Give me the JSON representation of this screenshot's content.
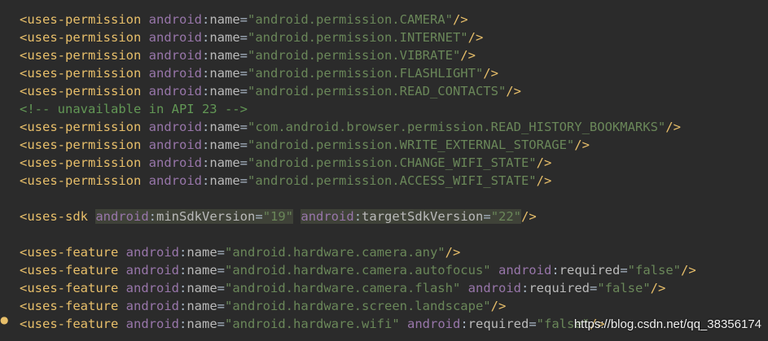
{
  "lines": [
    {
      "kind": "element",
      "tag": "<uses-permission",
      "attrs": [
        {
          "ns": "android",
          "name": "name",
          "value": "\"android.permission.CAMERA\""
        }
      ],
      "end": "/>"
    },
    {
      "kind": "element",
      "tag": "<uses-permission",
      "attrs": [
        {
          "ns": "android",
          "name": "name",
          "value": "\"android.permission.INTERNET\""
        }
      ],
      "end": "/>"
    },
    {
      "kind": "element",
      "tag": "<uses-permission",
      "attrs": [
        {
          "ns": "android",
          "name": "name",
          "value": "\"android.permission.VIBRATE\""
        }
      ],
      "end": "/>"
    },
    {
      "kind": "element",
      "tag": "<uses-permission",
      "attrs": [
        {
          "ns": "android",
          "name": "name",
          "value": "\"android.permission.FLASHLIGHT\""
        }
      ],
      "end": "/>"
    },
    {
      "kind": "element",
      "tag": "<uses-permission",
      "attrs": [
        {
          "ns": "android",
          "name": "name",
          "value": "\"android.permission.READ_CONTACTS\""
        }
      ],
      "end": "/>"
    },
    {
      "kind": "comment",
      "text": "<!-- unavailable in API 23 -->"
    },
    {
      "kind": "element",
      "tag": "<uses-permission",
      "attrs": [
        {
          "ns": "android",
          "name": "name",
          "value": "\"com.android.browser.permission.READ_HISTORY_BOOKMARKS\""
        }
      ],
      "end": "/>"
    },
    {
      "kind": "element",
      "tag": "<uses-permission",
      "attrs": [
        {
          "ns": "android",
          "name": "name",
          "value": "\"android.permission.WRITE_EXTERNAL_STORAGE\""
        }
      ],
      "end": "/>"
    },
    {
      "kind": "element",
      "tag": "<uses-permission",
      "attrs": [
        {
          "ns": "android",
          "name": "name",
          "value": "\"android.permission.CHANGE_WIFI_STATE\""
        }
      ],
      "end": "/>"
    },
    {
      "kind": "element",
      "tag": "<uses-permission",
      "attrs": [
        {
          "ns": "android",
          "name": "name",
          "value": "\"android.permission.ACCESS_WIFI_STATE\""
        }
      ],
      "end": "/>"
    },
    {
      "kind": "blank"
    },
    {
      "kind": "element",
      "tag": "<uses-sdk",
      "attrs": [
        {
          "ns": "android",
          "name": "minSdkVersion",
          "value": "\"19\"",
          "highlight": true
        },
        {
          "ns": "android",
          "name": "targetSdkVersion",
          "value": "\"22\"",
          "highlight": true
        }
      ],
      "end": "/>"
    },
    {
      "kind": "blank"
    },
    {
      "kind": "element",
      "tag": "<uses-feature",
      "attrs": [
        {
          "ns": "android",
          "name": "name",
          "value": "\"android.hardware.camera.any\""
        }
      ],
      "end": "/>"
    },
    {
      "kind": "element",
      "tag": "<uses-feature",
      "attrs": [
        {
          "ns": "android",
          "name": "name",
          "value": "\"android.hardware.camera.autofocus\""
        },
        {
          "ns": "android",
          "name": "required",
          "value": "\"false\""
        }
      ],
      "end": "/>"
    },
    {
      "kind": "element",
      "tag": "<uses-feature",
      "attrs": [
        {
          "ns": "android",
          "name": "name",
          "value": "\"android.hardware.camera.flash\""
        },
        {
          "ns": "android",
          "name": "required",
          "value": "\"false\""
        }
      ],
      "end": "/>"
    },
    {
      "kind": "element",
      "tag": "<uses-feature",
      "attrs": [
        {
          "ns": "android",
          "name": "name",
          "value": "\"android.hardware.screen.landscape\""
        }
      ],
      "end": "/>"
    },
    {
      "kind": "element",
      "tag": "<uses-feature",
      "attrs": [
        {
          "ns": "android",
          "name": "name",
          "value": "\"android.hardware.wifi\""
        },
        {
          "ns": "android",
          "name": "required",
          "value": "\"false\""
        }
      ],
      "end": "/>"
    }
  ],
  "watermark": "https://blog.csdn.net/qq_38356174",
  "gutter_icon": "lightbulb-icon",
  "colors": {
    "background": "#2b2b2b",
    "tag": "#e8bf6a",
    "namespace": "#9876aa",
    "attribute": "#bababa",
    "string": "#6a8759",
    "comment": "#629755",
    "highlight": "#3f4238"
  }
}
